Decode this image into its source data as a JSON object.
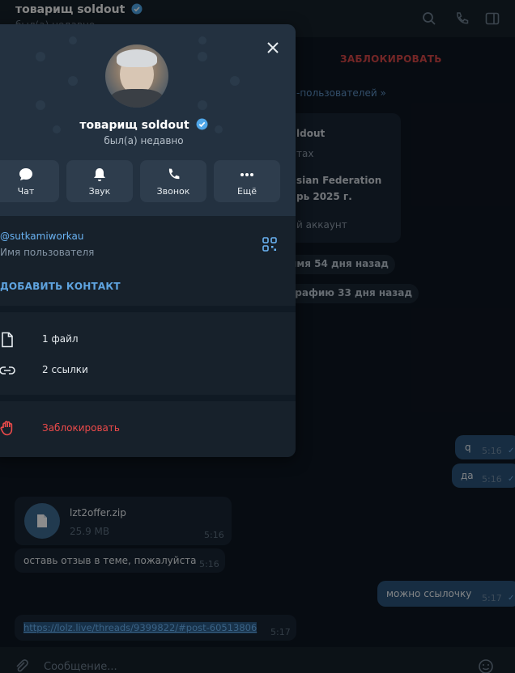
{
  "header": {
    "title": "товарищ soldout",
    "subtitle": "был(а) недавно",
    "verified_icon": "verified-badge-icon"
  },
  "chat": {
    "block_banner": "ЗАБЛОКИРОВАТЬ",
    "banner_link": "-пользователей »",
    "bot_card": {
      "line1": "ldout",
      "line2": "тах",
      "line3": "sian Federation",
      "line4": "рь 2025 г.",
      "line5": "й аккаунт"
    },
    "service_messages": [
      "имя 54 дня назад",
      "графию 33 дня назад"
    ],
    "messages": [
      {
        "text": "q",
        "time": "5:16",
        "direction": "out"
      },
      {
        "text": "да",
        "time": "5:16",
        "direction": "out"
      },
      {
        "file_name": "lzt2offer.zip",
        "file_size": "25.9 MB",
        "time": "5:16",
        "direction": "in"
      },
      {
        "text": "оставь отзыв в теме, пожалуйста",
        "time": "5:16",
        "direction": "in"
      },
      {
        "text": "можно ссылочку",
        "time": "5:17",
        "direction": "out"
      },
      {
        "text": "https://lolz.live/threads/9399822/#post-60513806",
        "time": "5:17",
        "direction": "in"
      }
    ],
    "input_placeholder": "Сообщение..."
  },
  "profile": {
    "name": "товарищ soldout",
    "status": "был(а) недавно",
    "actions": [
      {
        "label": "Чат",
        "icon": "chat-bubble-icon"
      },
      {
        "label": "Звук",
        "icon": "bell-icon"
      },
      {
        "label": "Звонок",
        "icon": "phone-icon"
      },
      {
        "label": "Ещё",
        "icon": "more-dots-icon"
      }
    ],
    "username": "@sutkamiworkau",
    "username_label": "Имя пользователя",
    "add_contact": "ДОБАВИТЬ КОНТАКТ",
    "media": [
      {
        "label": "1 файл",
        "icon": "file-icon"
      },
      {
        "label": "2 ссылки",
        "icon": "link-icon"
      }
    ],
    "block_label": "Заблокировать"
  },
  "colors": {
    "accent": "#6ab3f3",
    "danger": "#ec4a4a",
    "outgoing_bubble": "#2b5278",
    "incoming_bubble": "#182533"
  }
}
